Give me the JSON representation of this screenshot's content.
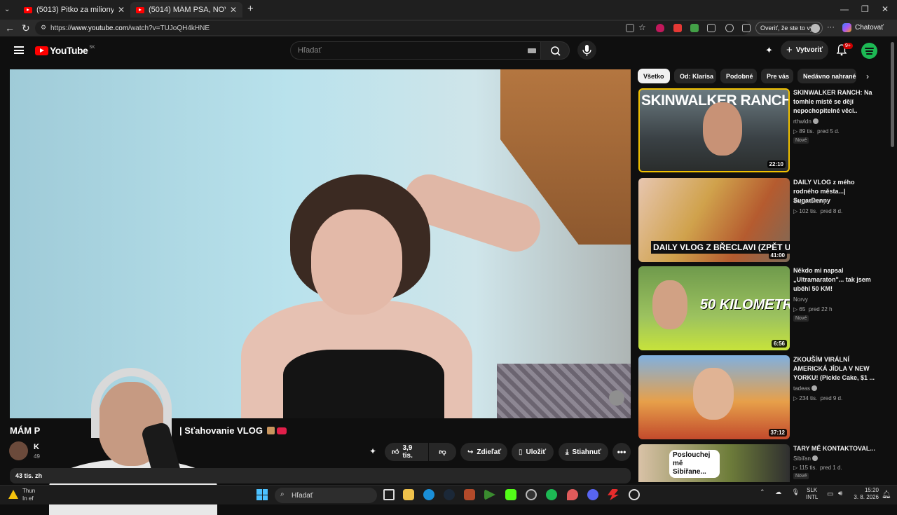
{
  "browser": {
    "tabs": [
      {
        "label": "(5013) Pitko za miliony? Opravili jí"
      },
      {
        "label": "(5014) MÁM PSA, NOVÚ KÉRKU A"
      }
    ],
    "url_prefix": "https://",
    "url_host": "www.youtube.com",
    "url_path": "/watch?v=TUJoQH4kHNE",
    "verify_label": "Overiť, že ste to vy",
    "chat_label": "Chatovať"
  },
  "youtube": {
    "logo_text": "YouTube",
    "country_code": "SK",
    "search_placeholder": "Hľadať",
    "create_label": "Vytvoriť",
    "notif_badge": "9+"
  },
  "video": {
    "title_start": "MÁM P",
    "title_end": "| Sťahovanie VLOG",
    "channel_initial": "K",
    "subs_partial": "49",
    "likes": "3,9 tis.",
    "share_label": "Zdieľať",
    "save_label": "Uložiť",
    "download_label": "Stiahnuť",
    "more_label": "•••",
    "desc_views": "43 tis. zh"
  },
  "sidebar": {
    "chips": [
      "Všetko",
      "Od: Klarisa",
      "Podobné",
      "Pre vás",
      "Nedávno nahrané"
    ],
    "recommendations": [
      {
        "title": "SKINWALKER RANCH: Na tomhle místě se dějí nepochopitelné věci..",
        "channel": "rthwldn",
        "verified": true,
        "views": "89 tis.",
        "age": "pred 5 d.",
        "badge": "Nové",
        "duration": "22:10",
        "thumb_text": "SKINWALKER RANCH"
      },
      {
        "title": "DAILY VLOG z mého rodného města...| SugarDenny",
        "channel": "Sugar Denny",
        "verified": false,
        "views": "102 tis.",
        "age": "pred 8 d.",
        "badge": "",
        "duration": "41:00",
        "thumb_text": "DAILY VLOG Z BŘECLAVI (ZPĚT U RODIČŮ)"
      },
      {
        "title": "Někdo mi napsal „Ultramaraton\"... tak jsem uběhl 50 KM!",
        "channel": "Norvy",
        "verified": false,
        "views": "65",
        "age": "pred 22 h",
        "badge": "Nové",
        "duration": "6:56",
        "thumb_text": "50 KILOMETRŮ"
      },
      {
        "title": "ZKOUŠÍM VIRÁLNÍ AMERICKÁ JÍDLA V NEW YORKU! (Pickle Cake, $1 ...",
        "channel": "tadeas",
        "verified": true,
        "views": "234 tis.",
        "age": "pred 9 d.",
        "badge": "",
        "duration": "37:12",
        "thumb_text": ""
      },
      {
        "title": "TARY MĚ KONTAKTOVAL...",
        "channel": "Sibiřan",
        "verified": true,
        "views": "115 tis.",
        "age": "pred 1 d.",
        "badge": "Nové",
        "duration": "",
        "thumb_text": "Poslouchej mě Sibiřane..."
      }
    ]
  },
  "taskbar": {
    "weather_line1": "Thun",
    "weather_line2": "In ef",
    "search_label": "Hľadať",
    "lang_line1": "SLK",
    "lang_line2": "INTL",
    "time": "15:20",
    "date": "3. 8. 2026"
  },
  "colors": {
    "youtube_red": "#ff0000",
    "chip_selected": "#f1f1f1",
    "background": "#0f0f0f"
  }
}
